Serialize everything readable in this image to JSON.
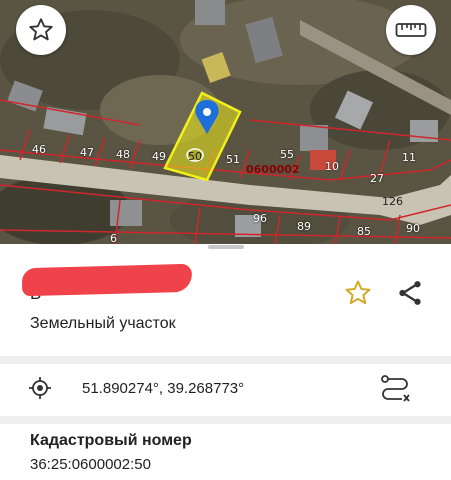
{
  "map": {
    "plot_numbers": [
      "46",
      "47",
      "48",
      "49",
      "50",
      "51",
      "55",
      "10",
      "11",
      "27",
      "126",
      "96",
      "89",
      "85",
      "90",
      "6"
    ],
    "quarter_code": "0600002",
    "colors": {
      "boundary": "#d0262b",
      "selected": "#f2ef19",
      "pin": "#1e6fd9"
    }
  },
  "buttons": {
    "favorite_icon": "star-icon",
    "measure_icon": "ruler-icon"
  },
  "listing": {
    "owner_name": "В",
    "subtitle": "Земельный участок",
    "redaction_color": "#f0424a"
  },
  "coords": {
    "text": "51.890274°, 39.268773°"
  },
  "cadastral": {
    "label": "Кадастровый номер",
    "value": "36:25:0600002:50"
  }
}
